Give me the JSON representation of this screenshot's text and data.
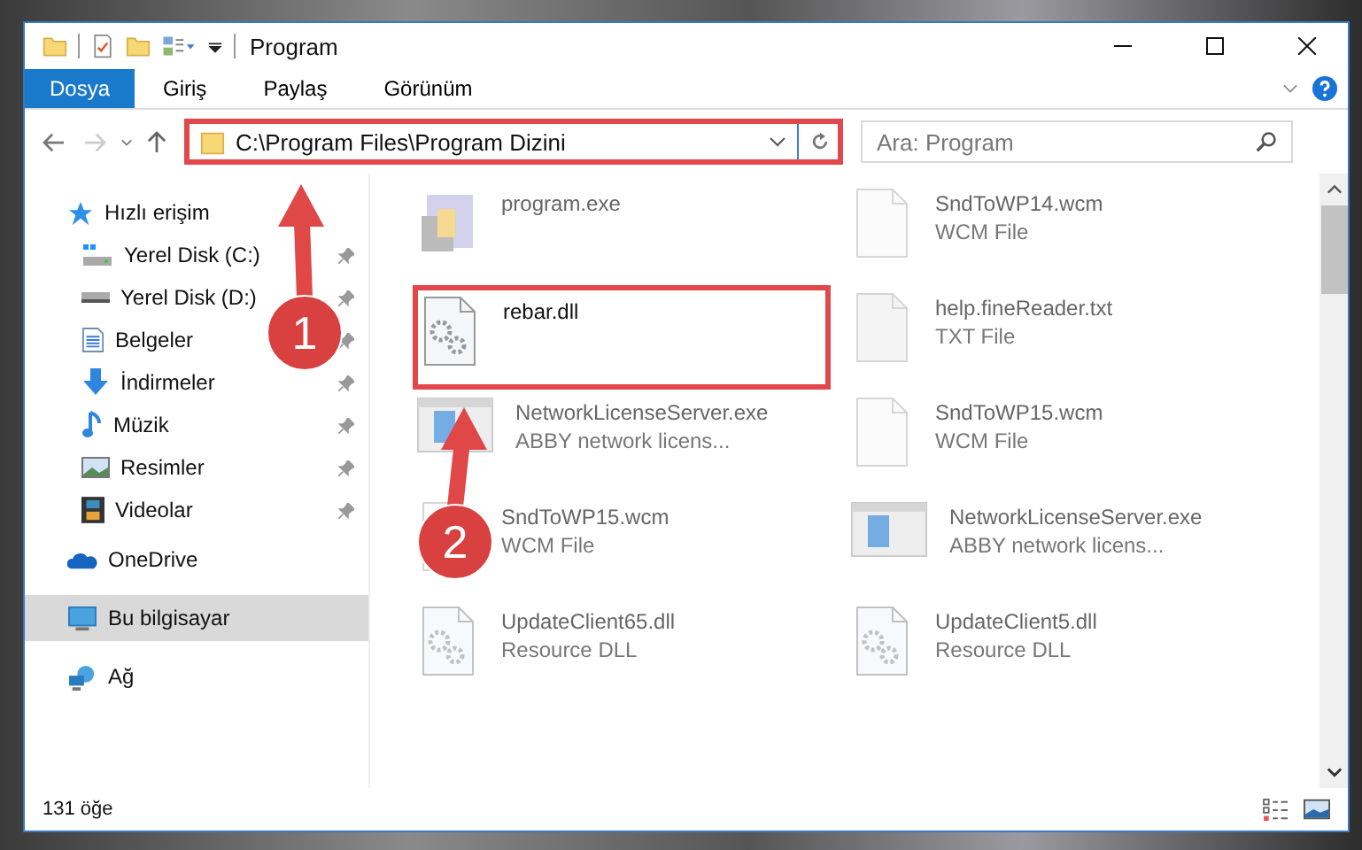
{
  "window": {
    "title": "Program"
  },
  "ribbon_tabs": [
    {
      "label": "Dosya",
      "selected": true
    },
    {
      "label": "Giriş",
      "selected": false
    },
    {
      "label": "Paylaş",
      "selected": false
    },
    {
      "label": "Görünüm",
      "selected": false
    }
  ],
  "address_bar": {
    "path": "C:\\Program Files\\Program Dizini",
    "highlighted": true
  },
  "search": {
    "placeholder": "Ara: Program"
  },
  "navigation": [
    {
      "label": "Hızlı erişim",
      "kind": "star",
      "selected": false,
      "children": [
        {
          "label": "Yerel Disk (C:)",
          "kind": "drive-c",
          "selected": false
        },
        {
          "label": "Yerel Disk (D:)",
          "kind": "drive",
          "selected": false
        },
        {
          "label": "Belgeler",
          "kind": "docs",
          "selected": false
        },
        {
          "label": "İndirmeler",
          "kind": "download",
          "selected": false
        },
        {
          "label": "Müzik",
          "kind": "music",
          "selected": false
        },
        {
          "label": "Resimler",
          "kind": "pictures",
          "selected": false
        },
        {
          "label": "Videolar",
          "kind": "videos",
          "selected": false
        }
      ]
    },
    {
      "label": "OneDrive",
      "kind": "cloud",
      "selected": false
    },
    {
      "label": "Bu bilgisayar",
      "kind": "pc",
      "selected": true
    },
    {
      "label": "Ağ",
      "kind": "network",
      "selected": false
    }
  ],
  "files": [
    {
      "name": "program.exe",
      "kind": "exe",
      "blurred": true,
      "highlighted": false
    },
    {
      "name": "SndToWP14.wcm",
      "type": "WCM File",
      "kind": "doc",
      "blurred": true,
      "highlighted": false
    },
    {
      "name": "rebar.dll",
      "kind": "dll",
      "blurred": false,
      "highlighted": true
    },
    {
      "name": "help.fineReader.txt",
      "type": "TXT File",
      "kind": "txt",
      "blurred": true,
      "highlighted": false
    },
    {
      "name": "NetworkLicenseServer.exe",
      "type": "ABBY network licens...",
      "kind": "app",
      "blurred": true,
      "highlighted": false
    },
    {
      "name": "SndToWP15.wcm",
      "type": "WCM File",
      "kind": "doc",
      "blurred": true,
      "highlighted": false
    },
    {
      "name": "SndToWP15.wcm",
      "type": "WCM File",
      "kind": "doc",
      "blurred": true,
      "highlighted": false
    },
    {
      "name": "NetworkLicenseServer.exe",
      "type": "ABBY network licens...",
      "kind": "app",
      "blurred": true,
      "highlighted": false
    },
    {
      "name": "UpdateClient65.dll",
      "type": "Resource DLL",
      "kind": "dll",
      "blurred": true,
      "highlighted": false
    },
    {
      "name": "UpdateClient5.dll",
      "type": "Resource DLL",
      "kind": "dll",
      "blurred": true,
      "highlighted": false
    }
  ],
  "status_bar": {
    "item_count": "131 öğe"
  },
  "annotations": [
    {
      "number": "1"
    },
    {
      "number": "2"
    }
  ]
}
